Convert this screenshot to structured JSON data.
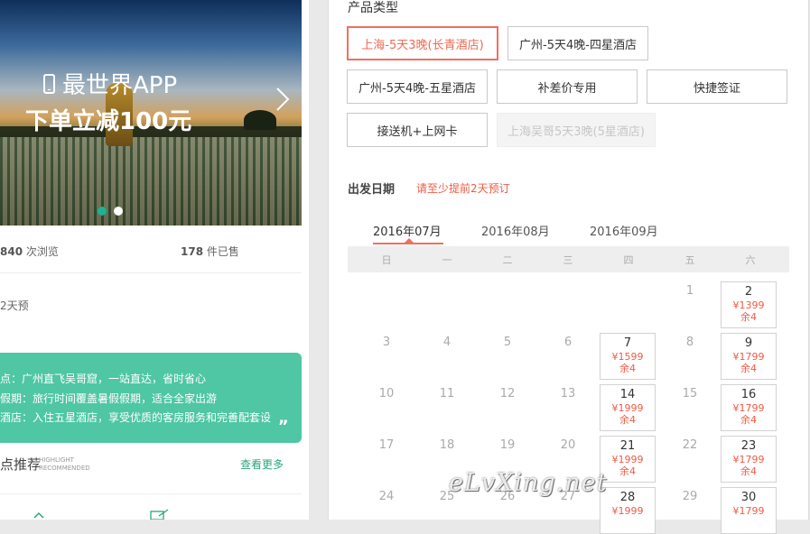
{
  "banner": {
    "app_text": "最世界APP",
    "promo_text": "下单立减100元"
  },
  "stats": {
    "views_count": "840",
    "views_label": "次浏览",
    "sold_count": "178",
    "sold_label": "件已售"
  },
  "booking_note": "2天预",
  "features": [
    "亮点：广州直飞吴哥窟，一站直达，省时省心",
    "假期：旅行时间覆盖暑假假期，适合全家出游",
    "酒店：入住五星酒店，享受优质的客房服务和完善配套设"
  ],
  "features_visible": [
    "点：广州直飞吴哥窟，一站直达，省时省心",
    "假期：旅行时间覆盖暑假假期，适合全家出游",
    "酒店：入住五星酒店，享受优质的客房服务和完善配套设"
  ],
  "highlight": {
    "title": "点推荐",
    "en1": "HIGHLIGHT",
    "en2": "RECOMMENDED",
    "more": "查看更多"
  },
  "product": {
    "section_title": "产品类型",
    "options": [
      {
        "label": "上海-5天3晚(长青酒店)",
        "state": "selected"
      },
      {
        "label": "广州-5天4晚-四星酒店",
        "state": "normal"
      },
      {
        "label": "广州-5天4晚-五星酒店",
        "state": "normal"
      },
      {
        "label": "补差价专用",
        "state": "normal"
      },
      {
        "label": "快捷签证",
        "state": "normal"
      },
      {
        "label": "接送机+上网卡",
        "state": "normal"
      },
      {
        "label": "上海吴哥5天3晚(5星酒店)",
        "state": "disabled"
      }
    ]
  },
  "departure": {
    "title": "出发日期",
    "note": "请至少提前2天预订"
  },
  "months": [
    "2016年07月",
    "2016年08月",
    "2016年09月"
  ],
  "weekdays": [
    "日",
    "一",
    "二",
    "三",
    "四",
    "五",
    "六"
  ],
  "calendar": {
    "plain_days": [
      "1",
      "3",
      "4",
      "5",
      "6",
      "8",
      "10",
      "11",
      "12",
      "13",
      "15",
      "17",
      "18",
      "19",
      "20",
      "22",
      "24",
      "25",
      "26",
      "27",
      "29"
    ],
    "priced_days": [
      {
        "day": "2",
        "price": "¥1399",
        "stock": "余4"
      },
      {
        "day": "7",
        "price": "¥1599",
        "stock": "余4"
      },
      {
        "day": "9",
        "price": "¥1799",
        "stock": "余4"
      },
      {
        "day": "14",
        "price": "¥1999",
        "stock": "余4"
      },
      {
        "day": "16",
        "price": "¥1799",
        "stock": "余4"
      },
      {
        "day": "21",
        "price": "¥1999",
        "stock": "余4"
      },
      {
        "day": "23",
        "price": "¥1799",
        "stock": "余4"
      },
      {
        "day": "28",
        "price": "¥1999",
        "stock": ""
      },
      {
        "day": "30",
        "price": "¥1799",
        "stock": ""
      }
    ]
  },
  "watermark": "eLvXing.net",
  "colors": {
    "accent": "#ef6a55",
    "green": "#4fc6a4",
    "dot_active": "#1bb394"
  }
}
